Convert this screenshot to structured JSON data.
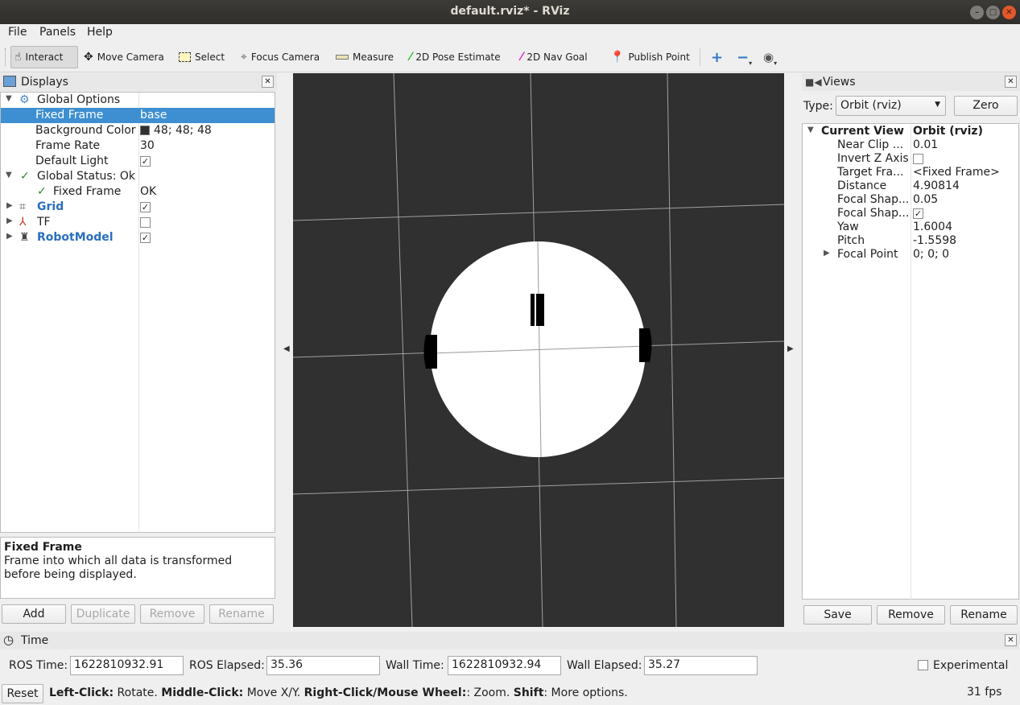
{
  "window": {
    "title": "default.rviz* - RViz"
  },
  "menu": [
    "File",
    "Panels",
    "Help"
  ],
  "toolbar": {
    "interact": "Interact",
    "move_camera": "Move Camera",
    "select": "Select",
    "focus_camera": "Focus Camera",
    "measure": "Measure",
    "pose_estimate": "2D Pose Estimate",
    "nav_goal": "2D Nav Goal",
    "publish_point": "Publish Point"
  },
  "displays": {
    "title": "Displays",
    "rows": {
      "global_options": "Global Options",
      "fixed_frame": {
        "label": "Fixed Frame",
        "value": "base"
      },
      "background_color": {
        "label": "Background Color",
        "value": "48; 48; 48"
      },
      "frame_rate": {
        "label": "Frame Rate",
        "value": "30"
      },
      "default_light": {
        "label": "Default Light",
        "checked": true
      },
      "global_status": "Global Status: Ok",
      "status_fixed_frame": {
        "label": "Fixed Frame",
        "value": "OK"
      },
      "grid": {
        "label": "Grid",
        "checked": true
      },
      "tf": {
        "label": "TF",
        "checked": false
      },
      "robot_model": {
        "label": "RobotModel",
        "checked": true
      }
    },
    "description": {
      "title": "Fixed Frame",
      "text": "Frame into which all data is transformed before being displayed."
    },
    "buttons": {
      "add": "Add",
      "duplicate": "Duplicate",
      "remove": "Remove",
      "rename": "Rename"
    }
  },
  "views": {
    "title": "Views",
    "type_label": "Type:",
    "type_value": "Orbit (rviz)",
    "zero": "Zero",
    "current_view": {
      "label": "Current View",
      "value": "Orbit (rviz)"
    },
    "props": [
      {
        "label": "Near Clip ...",
        "value": "0.01"
      },
      {
        "label": "Invert Z Axis",
        "value": ""
      },
      {
        "label": "Target Fra...",
        "value": "<Fixed Frame>"
      },
      {
        "label": "Distance",
        "value": "4.90814"
      },
      {
        "label": "Focal Shap...",
        "value": "0.05"
      },
      {
        "label": "Focal Shap...",
        "value": ""
      },
      {
        "label": "Yaw",
        "value": "1.6004"
      },
      {
        "label": "Pitch",
        "value": "-1.5598"
      },
      {
        "label": "Focal Point",
        "value": "0; 0; 0"
      }
    ],
    "checks": {
      "invert_z": false,
      "focal_shape_fixed": true
    },
    "buttons": {
      "save": "Save",
      "remove": "Remove",
      "rename": "Rename"
    }
  },
  "time": {
    "title": "Time",
    "ros_time_label": "ROS Time:",
    "ros_time": "1622810932.91",
    "ros_elapsed_label": "ROS Elapsed:",
    "ros_elapsed": "35.36",
    "wall_time_label": "Wall Time:",
    "wall_time": "1622810932.94",
    "wall_elapsed_label": "Wall Elapsed:",
    "wall_elapsed": "35.27",
    "experimental": "Experimental"
  },
  "status": {
    "reset": "Reset",
    "left_click": "Left-Click:",
    "left_click_desc": " Rotate. ",
    "middle_click": "Middle-Click:",
    "middle_click_desc": " Move X/Y. ",
    "right_click": "Right-Click/Mouse Wheel:",
    "right_click_desc": ": Zoom. ",
    "shift": "Shift",
    "shift_desc": ": More options.",
    "fps": "31 fps"
  },
  "colors": {
    "background": "#303030",
    "selection": "#3d8fd1",
    "robot_body": "#ffffff"
  }
}
